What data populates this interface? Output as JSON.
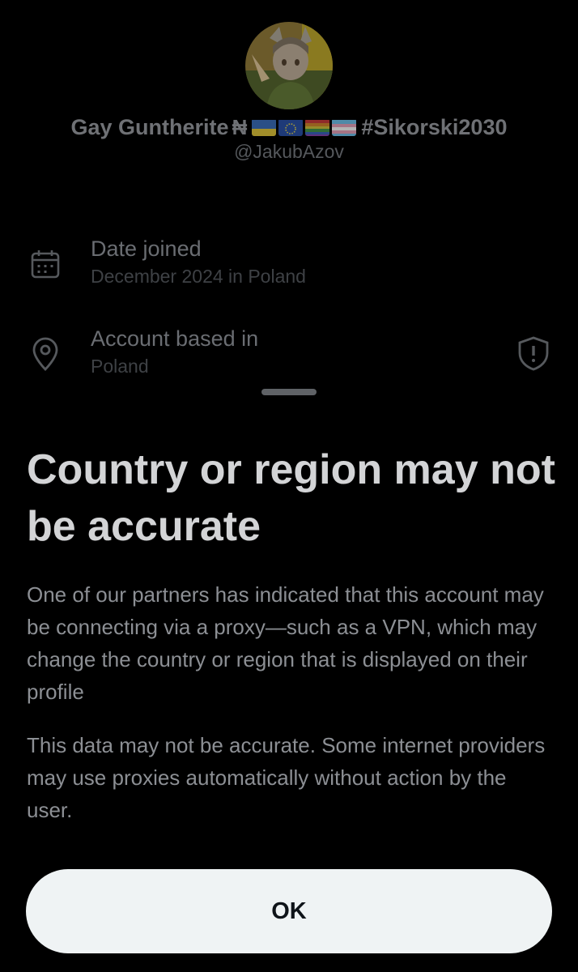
{
  "profile": {
    "display_name": "Gay Guntherite",
    "name_symbol": "₦",
    "hashtag": "#Sikorski2030",
    "handle": "@JakubAzov",
    "flags": [
      "ukraine-flag",
      "eu-flag",
      "rainbow-flag",
      "trans-flag"
    ]
  },
  "about": {
    "date_joined_label": "Date joined",
    "date_joined_value": "December 2024 in Poland",
    "based_in_label": "Account based in",
    "based_in_value": "Poland"
  },
  "icons": {
    "calendar": "calendar-icon",
    "location": "location-pin-icon",
    "shield": "shield-alert-icon"
  },
  "sheet": {
    "title": "Country or region may not be accurate",
    "paragraph_1": "One of our partners has indicated that this account may be connecting via a proxy—such as a VPN, which may change the country or region that is displayed on their profile",
    "paragraph_2": "This data may not be accurate. Some internet providers may use proxies automatically without action by the user.",
    "ok_label": "OK"
  },
  "colors": {
    "background": "#000000",
    "title_text": "#d3d4d6",
    "body_text": "#8c8f94",
    "button_bg": "#eff3f4",
    "button_text": "#0f1419"
  }
}
